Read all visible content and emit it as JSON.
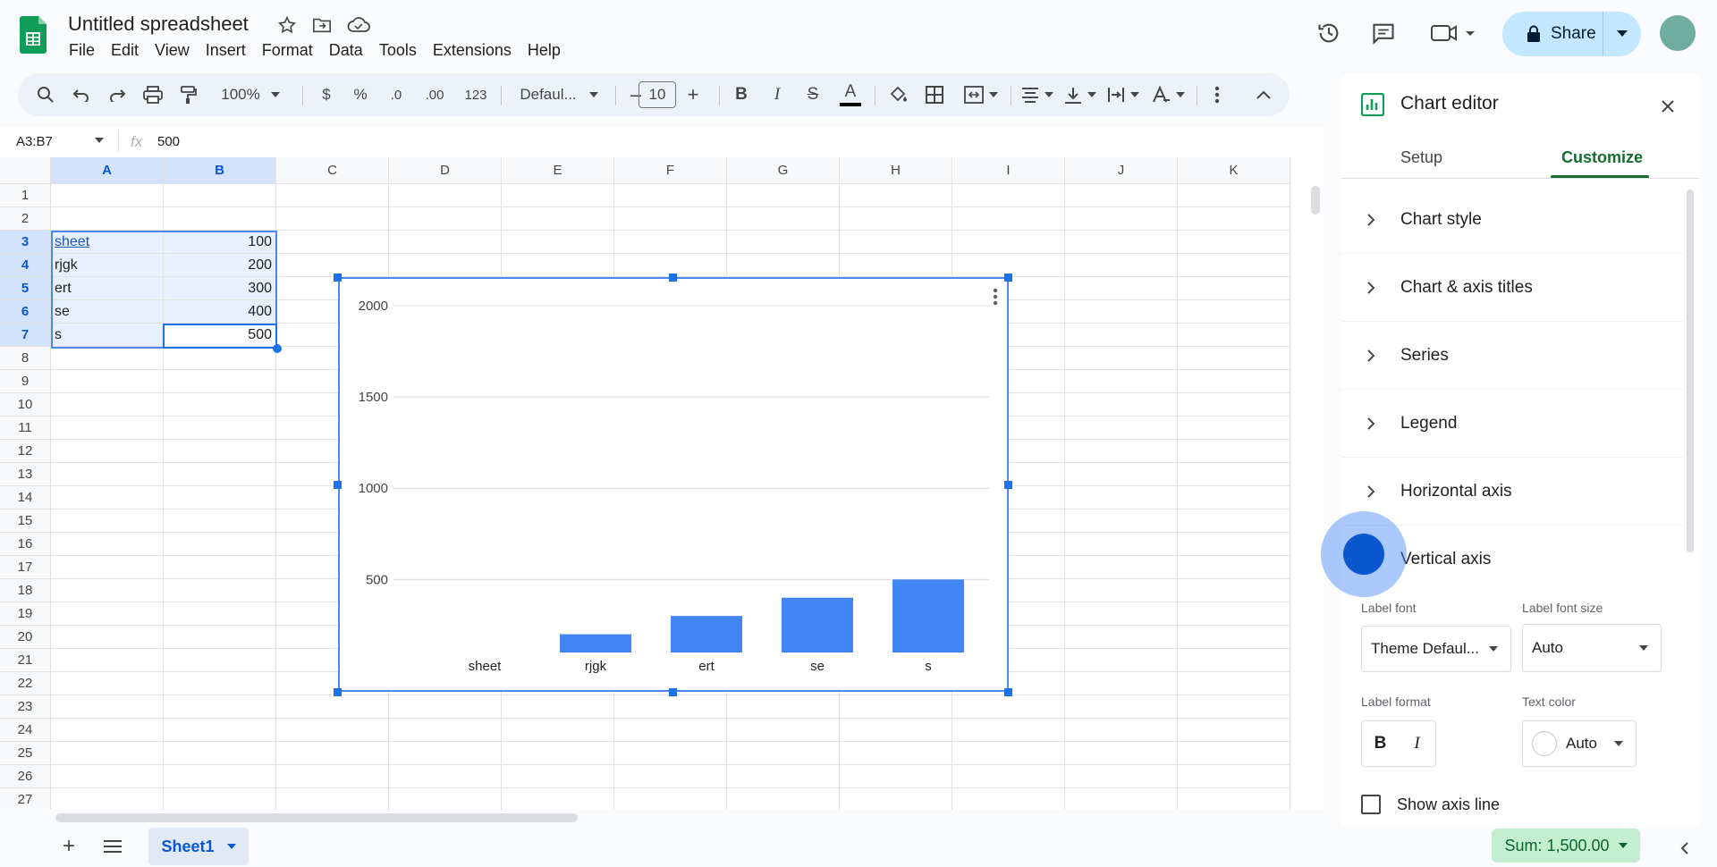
{
  "app": {
    "title": "Untitled spreadsheet",
    "menu": [
      "File",
      "Edit",
      "View",
      "Insert",
      "Format",
      "Data",
      "Tools",
      "Extensions",
      "Help"
    ],
    "share_label": "Share"
  },
  "toolbar": {
    "zoom": "100%",
    "currency": "$",
    "percent": "%",
    "dec_decrease": ".0",
    "dec_increase": ".00",
    "number_format": "123",
    "font": "Defaul...",
    "font_size": "10",
    "minus": "–",
    "plus": "+",
    "bold": "B",
    "italic": "I",
    "strike": "S",
    "text_color": "A"
  },
  "formula_bar": {
    "name_box": "A3:B7",
    "fx": "fx",
    "value": "500"
  },
  "sheet": {
    "columns": [
      "A",
      "B",
      "C",
      "D",
      "E",
      "F",
      "G",
      "H",
      "I",
      "J",
      "K"
    ],
    "rows": [
      "1",
      "2",
      "3",
      "4",
      "5",
      "6",
      "7",
      "8",
      "9",
      "10",
      "11",
      "12",
      "13",
      "14",
      "15",
      "16",
      "17",
      "18",
      "19",
      "20",
      "21",
      "22",
      "23",
      "24",
      "25",
      "26",
      "27"
    ],
    "data": [
      {
        "label": "sheet",
        "value": "100"
      },
      {
        "label": "rjgk",
        "value": "200"
      },
      {
        "label": "ert",
        "value": "300"
      },
      {
        "label": "se",
        "value": "400"
      },
      {
        "label": "s",
        "value": "500"
      }
    ]
  },
  "chart_data": {
    "type": "bar",
    "categories": [
      "sheet",
      "rjgk",
      "ert",
      "se",
      "s"
    ],
    "values": [
      100,
      200,
      300,
      400,
      500
    ],
    "title": "",
    "xlabel": "",
    "ylabel": "",
    "ylim": [
      100,
      2000
    ],
    "yticks": [
      "2000",
      "1500",
      "1000",
      "500"
    ],
    "ytick_values": [
      2000,
      1500,
      1000,
      500
    ],
    "bar_color": "#4285f4",
    "grid": true
  },
  "bottom": {
    "sheet_tab": "Sheet1",
    "sum": "Sum: 1,500.00",
    "add": "+"
  },
  "editor": {
    "title": "Chart editor",
    "tabs": [
      "Setup",
      "Customize"
    ],
    "active_tab": "Customize",
    "sections": [
      "Chart style",
      "Chart & axis titles",
      "Series",
      "Legend",
      "Horizontal axis",
      "Vertical axis"
    ],
    "label_font_label": "Label font",
    "label_font_value": "Theme Defaul...",
    "label_font_size_label": "Label font size",
    "label_font_size_value": "Auto",
    "label_format_label": "Label format",
    "text_color_label": "Text color",
    "text_color_value": "Auto",
    "bold": "B",
    "italic": "I",
    "show_axis_line": "Show axis line"
  },
  "colors": {
    "accent": "#0b57d0",
    "selection": "#e8f0fe",
    "active_tab": "#146c2e",
    "share_bg": "#c2e7ff",
    "sum_bg": "#c4eed0"
  }
}
